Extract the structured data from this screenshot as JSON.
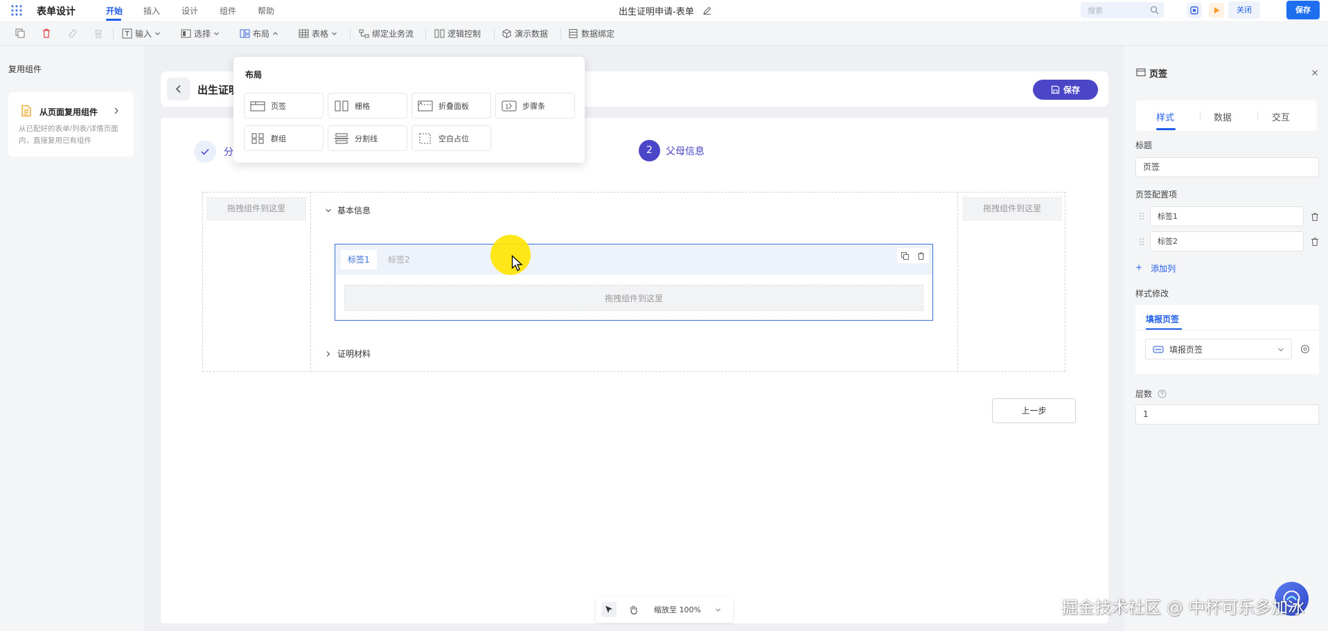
{
  "topbar": {
    "app_title": "表单设计",
    "menu": [
      "开始",
      "插入",
      "设计",
      "组件",
      "帮助"
    ],
    "doc_title": "出生证明申请-表单",
    "search_placeholder": "搜索",
    "close_label": "关闭",
    "save_label": "保存"
  },
  "toolbar": {
    "input": "输入",
    "select": "选择",
    "layout": "布局",
    "table": "表格",
    "bind_flow": "绑定业务流",
    "logic": "逻辑控制",
    "demo_data": "演示数据",
    "data_bind": "数据绑定"
  },
  "left_panel": {
    "title": "复用组件",
    "card_title": "从页面复用组件",
    "card_desc": "从已配好的表单/列表/详情页面内，直接复用已有组件"
  },
  "popup": {
    "title": "布局",
    "items": [
      "页签",
      "栅格",
      "折叠面板",
      "步骤条",
      "群组",
      "分割线",
      "空白占位"
    ]
  },
  "canvas": {
    "title": "出生证明",
    "save_label": "保存",
    "step1_label": "分",
    "step2_num": "2",
    "step2_label": "父母信息",
    "drop_hint": "拖拽组件到这里",
    "section_basic": "基本信息",
    "section_proof": "证明材料",
    "tab1": "标签1",
    "tab2": "标签2",
    "prev_label": "上一步"
  },
  "zoombar": {
    "zoom_label": "缩放至 100%"
  },
  "right_panel": {
    "title": "页签",
    "tabs": [
      "样式",
      "数据",
      "交互"
    ],
    "title_label": "标题",
    "title_value": "页签",
    "config_label": "页签配置项",
    "config_items": [
      "标签1",
      "标签2"
    ],
    "add_col": "添加列",
    "add_plus": "+",
    "style_label": "样式修改",
    "style_tab": "填报页签",
    "style_select": "填报页签",
    "levels_label": "层数",
    "levels_value": "1"
  },
  "watermark": "掘金技术社区 @ 中杯可乐多加冰",
  "colors": {
    "primary": "#1e5de8",
    "accent_purple": "#4b46c7",
    "cursor_highlight": "#ffe400"
  }
}
